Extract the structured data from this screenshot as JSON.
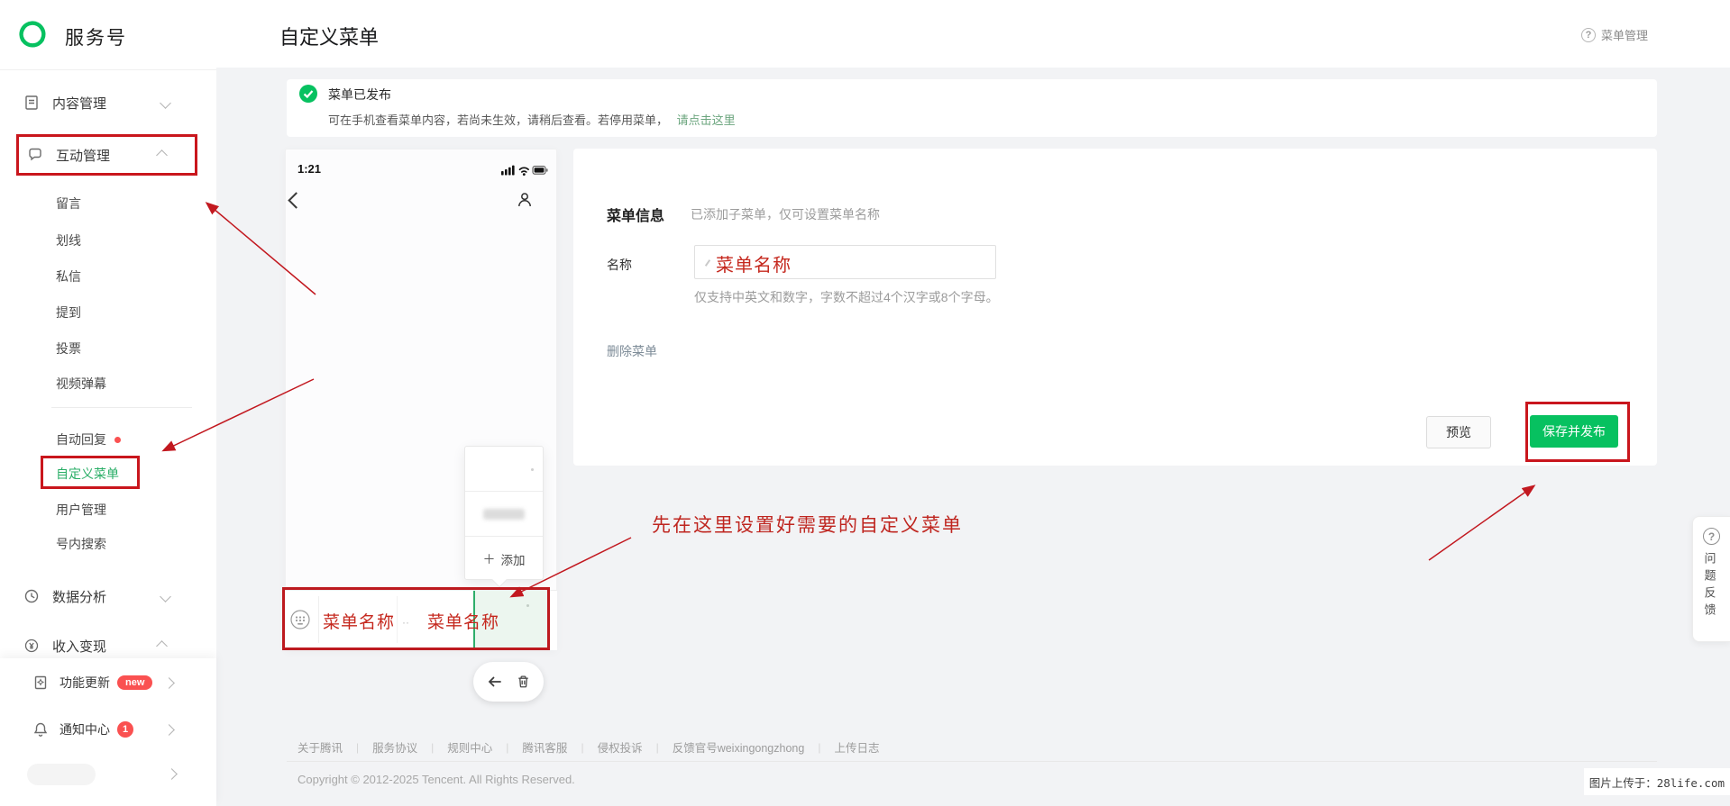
{
  "brand": {
    "name": "服务号"
  },
  "header": {
    "title": "自定义菜单",
    "help": "菜单管理"
  },
  "sidebar": {
    "content_mgmt": "内容管理",
    "interact_mgmt": "互动管理",
    "sub": [
      "留言",
      "划线",
      "私信",
      "提到",
      "投票",
      "视频弹幕"
    ],
    "auto_reply": "自动回复",
    "custom_menu": "自定义菜单",
    "user_mgmt": "用户管理",
    "account_search": "号内搜索",
    "data_analysis": "数据分析",
    "revenue": "收入变现",
    "feature_update": "功能更新",
    "feature_badge": "new",
    "notify_center": "通知中心",
    "notify_badge": "1"
  },
  "banner": {
    "title": "菜单已发布",
    "body": "可在手机查看菜单内容，若尚未生效，请稍后查看。若停用菜单，",
    "link": "请点击这里"
  },
  "phone": {
    "time": "1:21"
  },
  "popup": {
    "add_plus": "＋",
    "add_label": "添加"
  },
  "menu_bar": {
    "cell1": "菜单名称",
    "cell2": "菜单名称",
    "dots": "··"
  },
  "form": {
    "title": "菜单信息",
    "subtitle": "已添加子菜单，仅可设置菜单名称",
    "name_label": "名称",
    "name_value": "菜单名称",
    "hint": "仅支持中英文和数字，字数不超过4个汉字或8个字母。",
    "delete_link": "删除菜单",
    "preview_btn": "预览",
    "save_btn": "保存并发布"
  },
  "annotation": {
    "tip": "先在这里设置好需要的自定义菜单"
  },
  "feedback": {
    "icon": "?",
    "label": "问题反馈"
  },
  "footer": {
    "links": [
      "关于腾讯",
      "服务协议",
      "规则中心",
      "腾讯客服",
      "侵权投诉",
      "反馈官号weixingongzhong",
      "上传日志"
    ],
    "separator": "|",
    "copyright": "Copyright © 2012-2025 Tencent. All Rights Reserved."
  },
  "watermark": "图片上传于：28life.com",
  "icons": {
    "question": "?"
  },
  "colors": {
    "brand": "#07c160",
    "annotation_red": "#c9161d",
    "badge_red": "#fa5151"
  }
}
